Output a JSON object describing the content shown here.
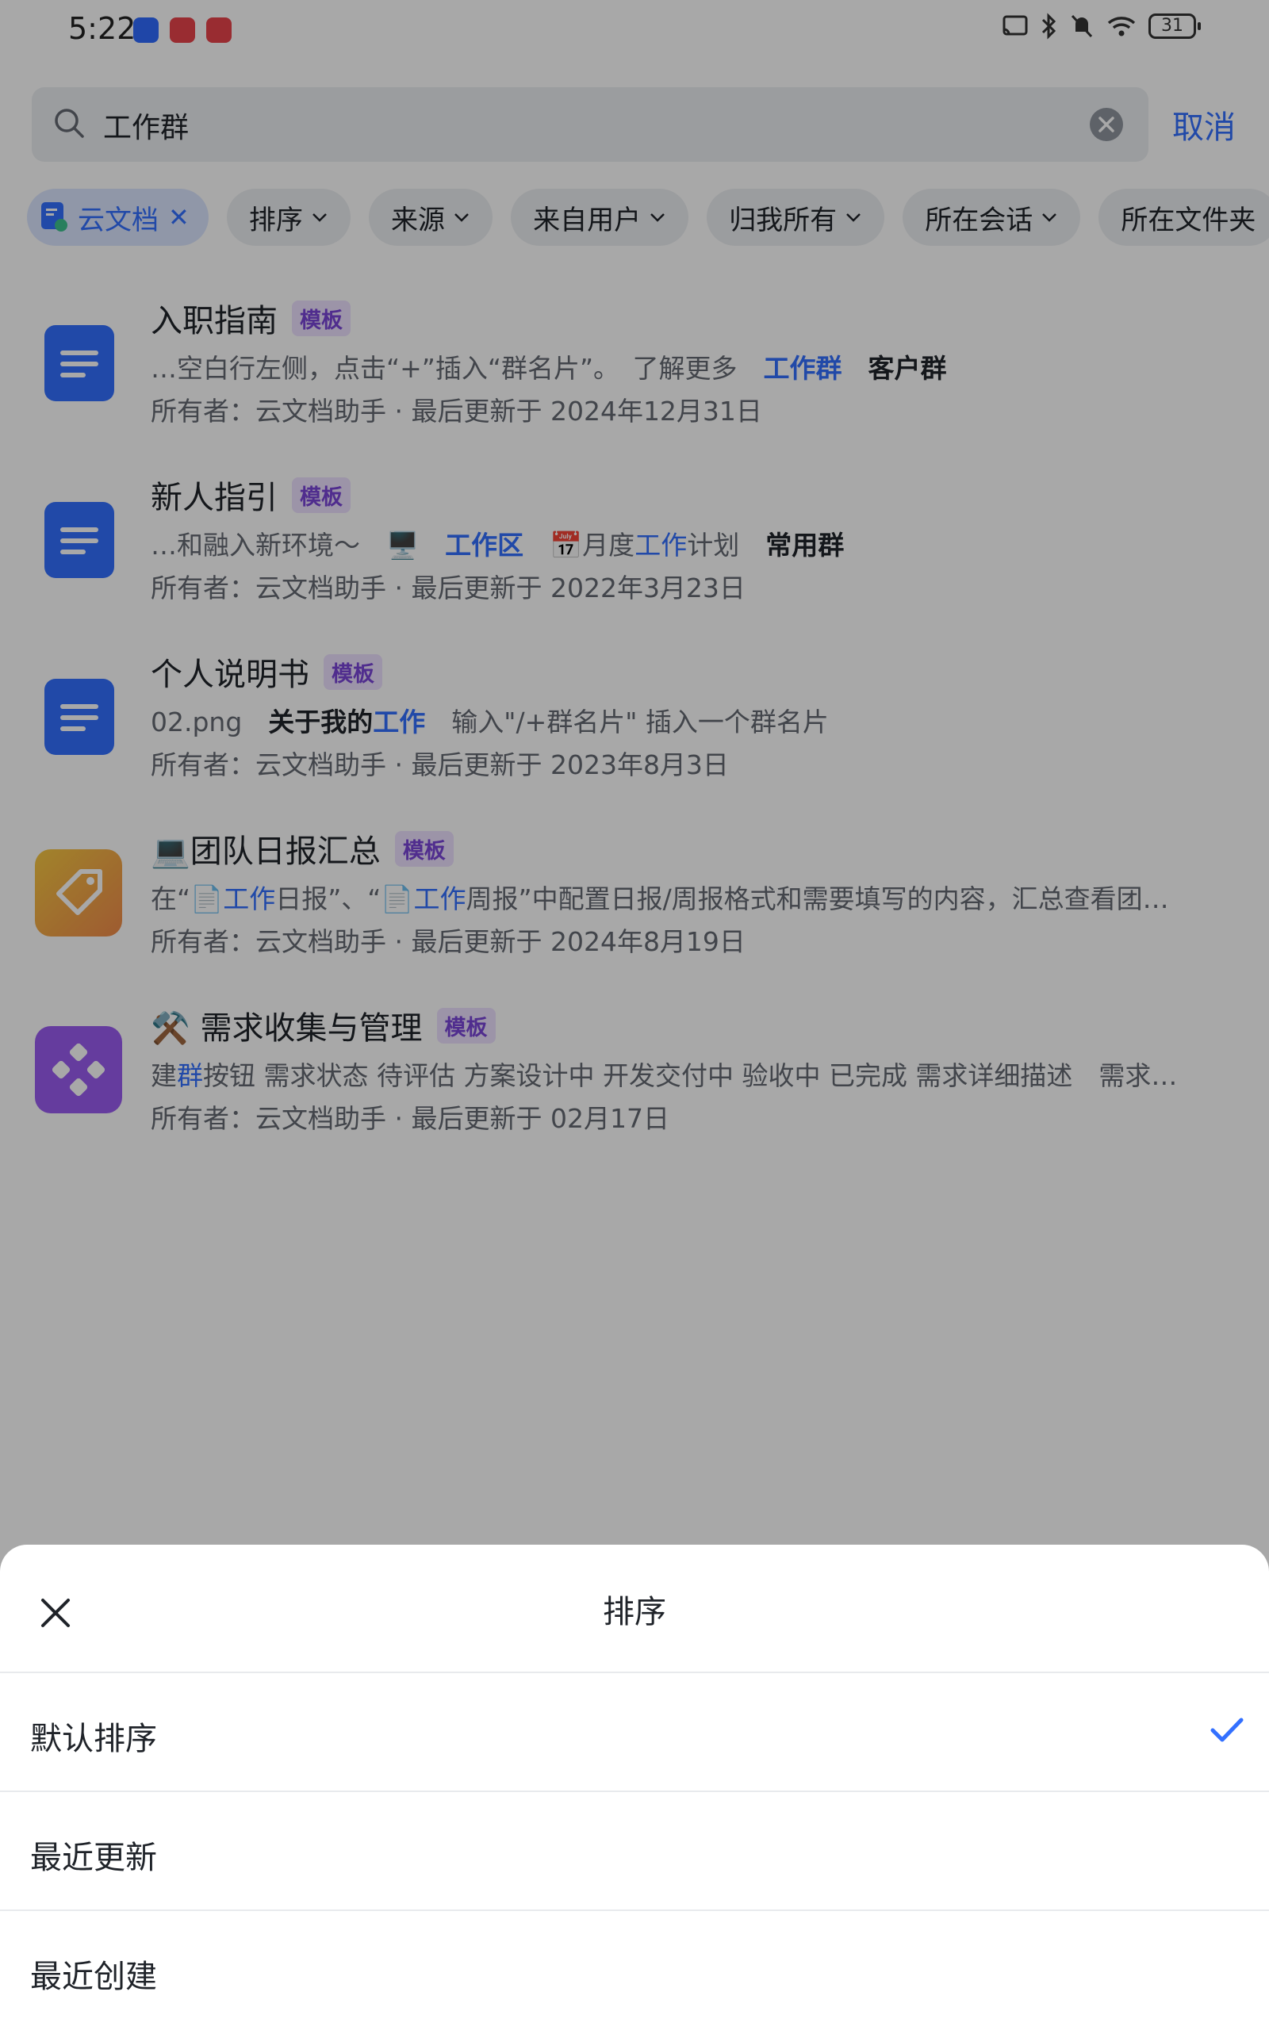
{
  "status_bar": {
    "time": "5:22",
    "battery": "31"
  },
  "search": {
    "query": "工作群",
    "cancel_label": "取消"
  },
  "filters": [
    {
      "label": "云文档",
      "active": true
    },
    {
      "label": "排序"
    },
    {
      "label": "来源"
    },
    {
      "label": "来自用户"
    },
    {
      "label": "归我所有"
    },
    {
      "label": "所在会话"
    },
    {
      "label": "所在文件夹"
    }
  ],
  "results": [
    {
      "title": "入职指南",
      "tag": "模板",
      "snippet_parts": [
        "…空白行左侧，点击“+”插入“群名片”。　了解更多　",
        "工作群",
        "　",
        "客户群"
      ],
      "meta": "所有者：云文档助手 · 最后更新于 2024年12月31日"
    },
    {
      "title": "新人指引",
      "tag": "模板",
      "snippet_parts": [
        "…和融入新环境～　🖥️　",
        "工作区",
        "　📅月度",
        "工作",
        "计划　",
        "常用群"
      ],
      "meta": "所有者：云文档助手 · 最后更新于 2022年3月23日"
    },
    {
      "title": "个人说明书",
      "tag": "模板",
      "snippet_parts": [
        "02.png　",
        "关于我的",
        "工作",
        "　输入\"/+群名片\" 插入一个群名片"
      ],
      "meta": "所有者：云文档助手 · 最后更新于 2023年8月3日"
    },
    {
      "title": "💻团队日报汇总",
      "tag": "模板",
      "snippet_parts": [
        "在“📄",
        "工作",
        "日报”、“📄",
        "工作",
        "周报”中配置日报/周报格式和需要填写的内容，汇总查看团…"
      ],
      "meta": "所有者：云文档助手 · 最后更新于 2024年8月19日"
    },
    {
      "title": "⚒️ 需求收集与管理",
      "tag": "模板",
      "snippet_parts": [
        "建",
        "群",
        "按钮 需求状态 待评估 方案设计中 开发交付中 验收中 已完成 需求详细描述　需求…"
      ],
      "meta": "所有者：云文档助手 · 最后更新于 02月17日"
    }
  ],
  "sheet": {
    "title": "排序",
    "options": [
      {
        "label": "默认排序",
        "selected": true
      },
      {
        "label": "最近更新"
      },
      {
        "label": "最近创建"
      }
    ]
  },
  "colors": {
    "accent": "#3370ff",
    "tag_bg": "#ede1ff",
    "tag_fg": "#7a45d8"
  }
}
